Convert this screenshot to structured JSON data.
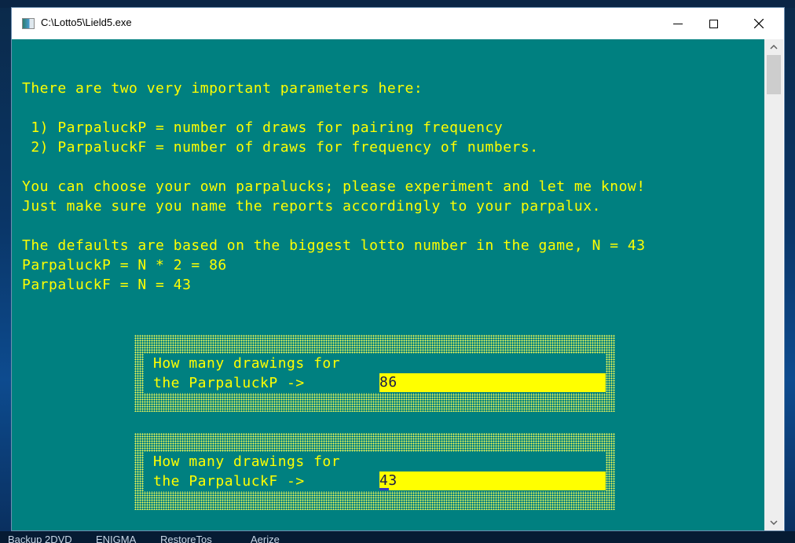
{
  "window": {
    "title": "C:\\Lotto5\\Lield5.exe",
    "controls": {
      "minimize": "minimize",
      "maximize": "maximize",
      "close": "close"
    }
  },
  "console": {
    "lines": [
      "There are two very important parameters here:",
      " 1) ParpaluckP = number of draws for pairing frequency",
      " 2) ParpaluckF = number of draws for frequency of numbers.",
      "You can choose your own parpalucks; please experiment and let me know!",
      "Just make sure you name the reports accordingly to your parpalux.",
      "The defaults are based on the biggest lotto number in the game, N = 43",
      "ParpaluckP = N * 2 = 86",
      "ParpaluckF = N = 43"
    ]
  },
  "prompts": [
    {
      "line1": "How many drawings for",
      "line2": "the ParpaluckP ->",
      "value": "86"
    },
    {
      "line1": "How many drawings for",
      "line2": "the ParpaluckF ->",
      "value": "43"
    }
  ],
  "scrollbar": {
    "up_icon": "▲",
    "down_icon": "▼"
  },
  "desktop": {
    "taskbar_labels": [
      "Backup 2DVD",
      "ENIGMA",
      "RestoreTos",
      "Aerize"
    ]
  },
  "colors": {
    "console_bg": "#008080",
    "console_text": "#FFFF00",
    "input_bg": "#FFFF00",
    "input_text": "#1A1A4A"
  }
}
